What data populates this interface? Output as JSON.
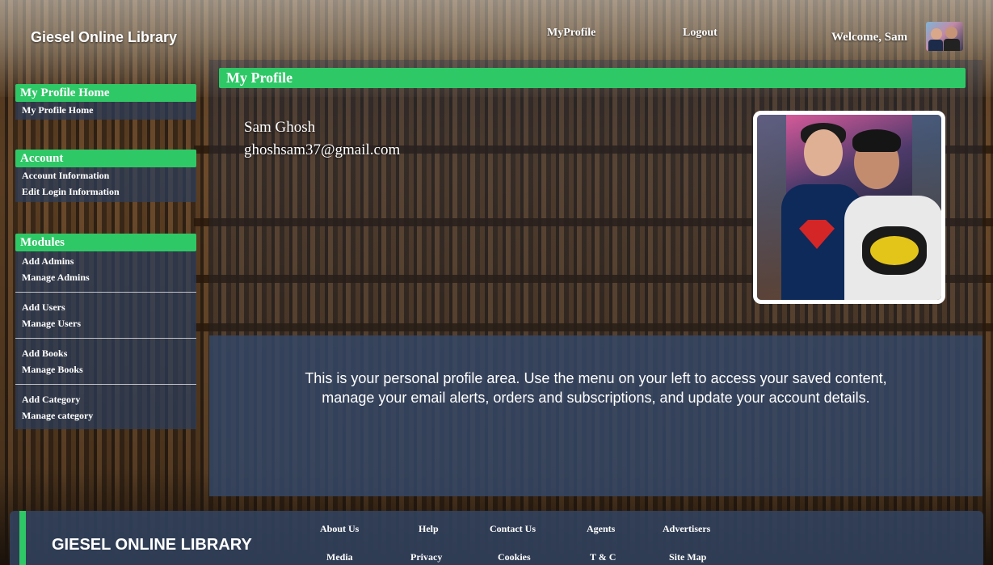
{
  "header": {
    "brand": "Giesel Online Library",
    "nav": {
      "myprofile": "MyProfile",
      "logout": "Logout"
    },
    "welcome": "Welcome, Sam"
  },
  "sidebar": {
    "profile": {
      "title": "My Profile Home",
      "links": [
        "My Profile Home"
      ]
    },
    "account": {
      "title": "Account",
      "links": [
        "Account Information",
        "Edit Login Information"
      ]
    },
    "modules": {
      "title": "Modules",
      "groups": [
        [
          "Add Admins",
          "Manage Admins"
        ],
        [
          "Add Users",
          "Manage Users"
        ],
        [
          "Add Books",
          "Manage Books"
        ],
        [
          "Add Category",
          "Manage category"
        ]
      ]
    }
  },
  "main": {
    "title": "My Profile",
    "user_name": "Sam Ghosh",
    "user_email": "ghoshsam37@gmail.com",
    "info_line1": "This is your personal profile area. Use the menu on your left to access your saved content,",
    "info_line2": "manage your email alerts, orders and subscriptions, and update your account details."
  },
  "footer": {
    "brand": "GIESEL ONLINE LIBRARY",
    "row1": [
      "About Us",
      "Help",
      "Contact Us",
      "Agents",
      "Advertisers"
    ],
    "row2": [
      "Media",
      "Privacy",
      "Cookies",
      "T & C",
      "Site Map"
    ]
  },
  "colors": {
    "accent": "#2ec866",
    "panel": "#344868"
  },
  "icons": {
    "header_avatar": "user-avatar-icon",
    "profile_photo": "profile-photo"
  }
}
